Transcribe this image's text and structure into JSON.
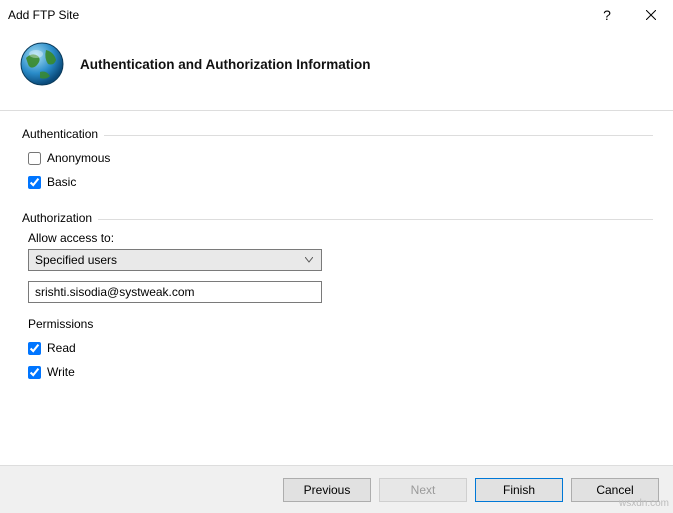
{
  "window": {
    "title": "Add FTP Site",
    "heading": "Authentication and Authorization Information"
  },
  "authentication": {
    "group_label": "Authentication",
    "anonymous_label": "Anonymous",
    "anonymous_checked": false,
    "basic_label": "Basic",
    "basic_checked": true
  },
  "authorization": {
    "group_label": "Authorization",
    "allow_access_label": "Allow access to:",
    "selected_option": "Specified users",
    "user_value": "srishti.sisodia@systweak.com",
    "permissions_label": "Permissions",
    "read_label": "Read",
    "read_checked": true,
    "write_label": "Write",
    "write_checked": true
  },
  "buttons": {
    "previous": "Previous",
    "next": "Next",
    "finish": "Finish",
    "cancel": "Cancel"
  },
  "watermark": "wsxdn.com"
}
